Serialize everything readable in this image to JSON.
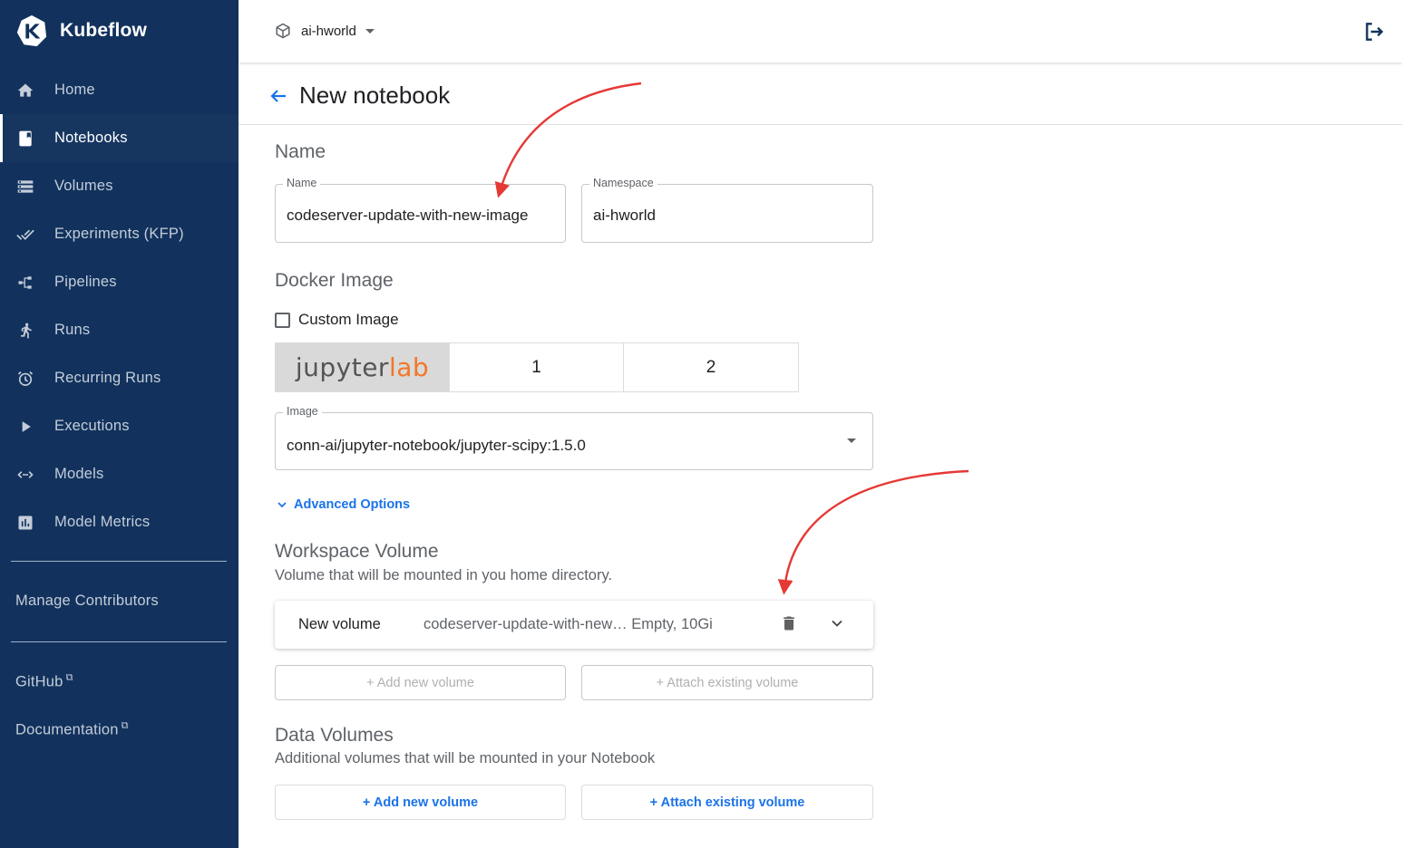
{
  "brand": {
    "name": "Kubeflow",
    "logo_icon": "kubeflow-logo-icon"
  },
  "sidebar": {
    "items": [
      {
        "label": "Home",
        "icon": "home-icon",
        "active": false
      },
      {
        "label": "Notebooks",
        "icon": "notebook-icon",
        "active": true
      },
      {
        "label": "Volumes",
        "icon": "storage-icon",
        "active": false
      },
      {
        "label": "Experiments (KFP)",
        "icon": "done-all-icon",
        "active": false
      },
      {
        "label": "Pipelines",
        "icon": "pipeline-icon",
        "active": false
      },
      {
        "label": "Runs",
        "icon": "runner-icon",
        "active": false
      },
      {
        "label": "Recurring Runs",
        "icon": "alarm-icon",
        "active": false
      },
      {
        "label": "Executions",
        "icon": "play-icon",
        "active": false
      },
      {
        "label": "Models",
        "icon": "arrows-horizontal-icon",
        "active": false
      },
      {
        "label": "Model Metrics",
        "icon": "chart-icon",
        "active": false
      }
    ],
    "manage_contributors": "Manage Contributors",
    "github": "GitHub",
    "documentation": "Documentation"
  },
  "topbar": {
    "namespace": "ai-hworld",
    "logout_icon": "logout-icon"
  },
  "page": {
    "title": "New notebook"
  },
  "form": {
    "name_section": "Name",
    "name_label": "Name",
    "name_value": "codeserver-update-with-new-image",
    "namespace_label": "Namespace",
    "namespace_value": "ai-hworld",
    "docker_section": "Docker Image",
    "custom_image_label": "Custom Image",
    "custom_image_checked": false,
    "image_tabs": [
      {
        "label_a": "jupyter",
        "label_b": "lab",
        "selected": true
      },
      {
        "label": "1",
        "selected": false
      },
      {
        "label": "2",
        "selected": false
      }
    ],
    "image_label": "Image",
    "image_value": "conn-ai/jupyter-notebook/jupyter-scipy:1.5.0",
    "advanced_options": "Advanced Options",
    "workspace_section": "Workspace Volume",
    "workspace_sub": "Volume that will be mounted in you home directory.",
    "workspace_volume": {
      "title": "New volume",
      "description": "codeserver-update-with-new…  Empty, 10Gi"
    },
    "workspace_add_new": "+ Add new volume",
    "workspace_attach": "+ Attach existing volume",
    "data_section": "Data Volumes",
    "data_sub": "Additional volumes that will be mounted in your Notebook",
    "data_add_new": "+ Add new volume",
    "data_attach": "+ Attach existing volume"
  },
  "colors": {
    "sidebar_bg": "#12325d",
    "accent": "#1a73e8",
    "annotation_arrow": "#e53935",
    "jupyter_orange": "#f37726"
  }
}
